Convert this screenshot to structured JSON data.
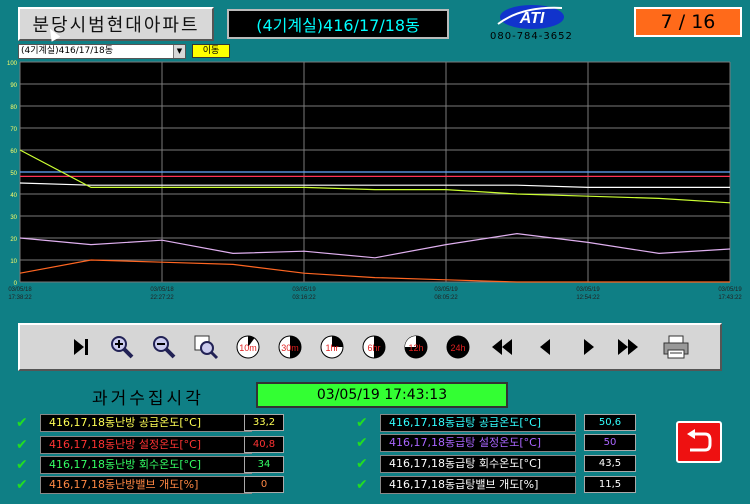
{
  "header": {
    "site_title": "분당시범현대아파트",
    "building_title": "(4기계실)416/17/18동",
    "logo_text": "ATI",
    "phone": "080-784-3652",
    "page_counter": "7 / 16"
  },
  "selector": {
    "selected": "(4기계실)416/17/18동",
    "move_label": "이동"
  },
  "chart_data": {
    "type": "line",
    "ylim": [
      0,
      100
    ],
    "yticks": [
      "0",
      "10",
      "20",
      "30",
      "40",
      "50",
      "60",
      "70",
      "80",
      "90",
      "100"
    ],
    "x_ticks": [
      {
        "date": "03/05/18",
        "time": "17:38:22"
      },
      {
        "date": "03/05/18",
        "time": "22:27:22"
      },
      {
        "date": "03/05/19",
        "time": "03:16:22"
      },
      {
        "date": "03/05/19",
        "time": "08:05:22"
      },
      {
        "date": "03/05/19",
        "time": "12:54:22"
      },
      {
        "date": "03/05/19",
        "time": "17:43:22"
      }
    ],
    "series": [
      {
        "color": "#66aaff",
        "values": [
          50,
          50,
          50,
          50,
          50,
          50,
          50,
          50,
          50,
          50,
          50
        ]
      },
      {
        "color": "#ffffff",
        "values": [
          45,
          44,
          44,
          44,
          44,
          44,
          44,
          44,
          43,
          43,
          43
        ]
      },
      {
        "color": "#ff3355",
        "values": [
          48,
          48,
          48,
          48,
          48,
          48,
          48,
          48,
          48,
          48,
          48
        ]
      },
      {
        "color": "#ccff33",
        "values": [
          60,
          43,
          43,
          43,
          43,
          42,
          42,
          40,
          39,
          38,
          36
        ]
      },
      {
        "color": "#e0b0f0",
        "values": [
          20,
          17,
          19,
          13,
          14,
          11,
          17,
          22,
          18,
          13,
          15
        ]
      },
      {
        "color": "#ff6622",
        "values": [
          4,
          10,
          9,
          8,
          4,
          2,
          1,
          0,
          0,
          0,
          0
        ]
      }
    ]
  },
  "toolbar": {
    "buttons": [
      "last",
      "zoom-in",
      "zoom-out",
      "zoom-reset",
      "10m",
      "30m",
      "1hr",
      "6hr",
      "12h",
      "24h",
      "rewind",
      "prev",
      "next",
      "fast-forward",
      "print"
    ],
    "labels": {
      "b10m": "10m",
      "b30m": "30m",
      "b1hr": "1hr",
      "b6hr": "6hr",
      "b12h": "12h",
      "b24h": "24h"
    }
  },
  "history": {
    "label": "과거수집시각",
    "time": "03/05/19 17:43:13"
  },
  "left_rows": [
    {
      "label": "416,17,18동난방 공급온도[°C]",
      "value": "33,2",
      "label_color": "#ffff55",
      "value_color": "#ffff55"
    },
    {
      "label": "416,17,18동난방 설정온도[°C]",
      "value": "40,8",
      "label_color": "#ff3333",
      "value_color": "#ff3333"
    },
    {
      "label": "416,17,18동난방 회수온도[°C]",
      "value": "34",
      "label_color": "#33ff66",
      "value_color": "#33ff66"
    },
    {
      "label": "416,17,18동난방밸브 개도[%]",
      "value": "0",
      "label_color": "#ff8844",
      "value_color": "#ff8844"
    }
  ],
  "right_rows": [
    {
      "label": "416,17,18동급탕 공급온도[°C]",
      "value": "50,6",
      "label_color": "#33ffff",
      "value_color": "#33ffff"
    },
    {
      "label": "416,17,18동급탕 설정온도[°C]",
      "value": "50",
      "label_color": "#aa66ff",
      "value_color": "#aa66ff"
    },
    {
      "label": "416,17,18동급탕 회수온도[°C]",
      "value": "43,5",
      "label_color": "#ffffff",
      "value_color": "#ffffff"
    },
    {
      "label": "416,17,18동급탕밸브 개도[%]",
      "value": "11,5",
      "label_color": "#ffffff",
      "value_color": "#ffffff"
    }
  ]
}
